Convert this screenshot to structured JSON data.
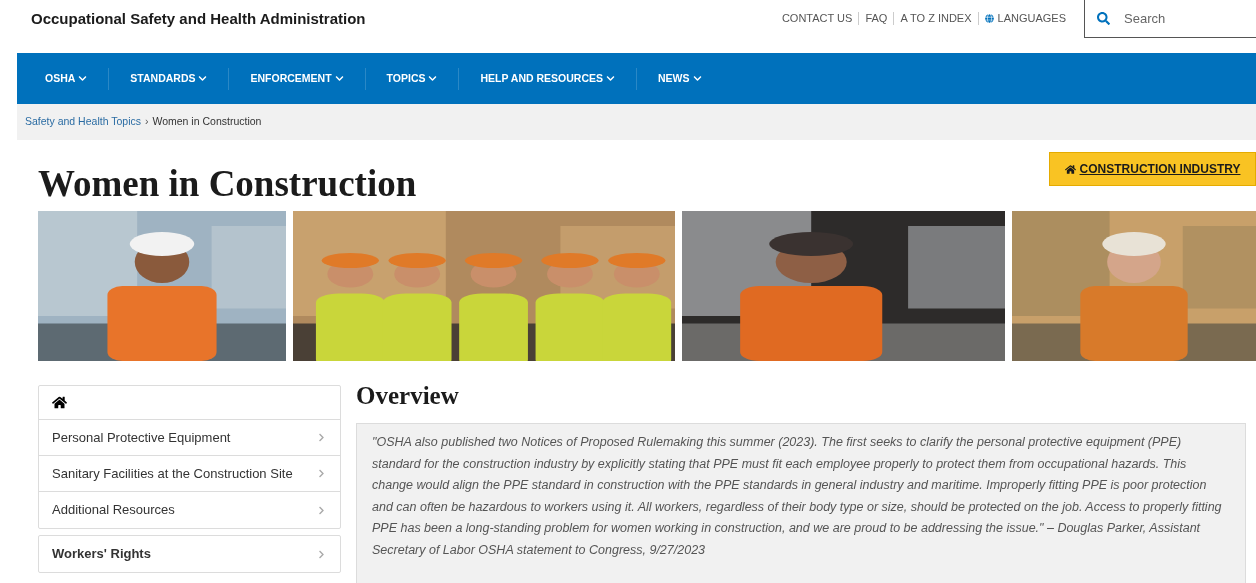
{
  "header": {
    "title": "Occupational Safety and Health Administration",
    "utility_links": [
      {
        "label": "CONTACT US",
        "kind": "link"
      },
      {
        "label": "FAQ",
        "kind": "link"
      },
      {
        "label": "A TO Z INDEX",
        "kind": "link"
      },
      {
        "label": "LANGUAGES",
        "kind": "globe"
      }
    ],
    "search": {
      "placeholder": "Search"
    }
  },
  "nav": [
    {
      "label": "OSHA"
    },
    {
      "label": "STANDARDS"
    },
    {
      "label": "ENFORCEMENT"
    },
    {
      "label": "TOPICS"
    },
    {
      "label": "HELP AND RESOURCES"
    },
    {
      "label": "NEWS"
    }
  ],
  "breadcrumb": [
    {
      "label": "Safety and Health Topics",
      "kind": "link"
    },
    {
      "label": "›",
      "kind": "separator"
    },
    {
      "label": "Women in Construction",
      "kind": "current"
    }
  ],
  "page_title": "Women in Construction",
  "industry_button": "CONSTRUCTION INDUSTRY",
  "sidebar": [
    {
      "items": [
        {
          "label": "Personal Protective Equipment"
        },
        {
          "label": "Sanitary Facilities at the Construction Site"
        },
        {
          "label": "Additional Resources"
        }
      ]
    },
    {
      "items": [
        {
          "label": "Workers' Rights"
        }
      ]
    }
  ],
  "overview": {
    "heading": "Overview",
    "quote": "\"OSHA also published two Notices of Proposed Rulemaking this summer (2023). The first seeks to clarify the personal protective equipment (PPE) standard for the construction industry by explicitly stating that PPE must fit each employee properly to protect them from occupational hazards. This change would align the PPE standard in construction with the PPE standards in general industry and maritime. Improperly fitting PPE is poor protection and can often be hazardous to workers using it. All workers, regardless of their body type or size, should be protected on the job. Access to properly fitting PPE has been a long-standing problem for women working in construction, and we are proud to be addressing the issue.\" – Douglas Parker, Assistant Secretary of Labor OSHA statement to Congress, 9/27/2023"
  }
}
